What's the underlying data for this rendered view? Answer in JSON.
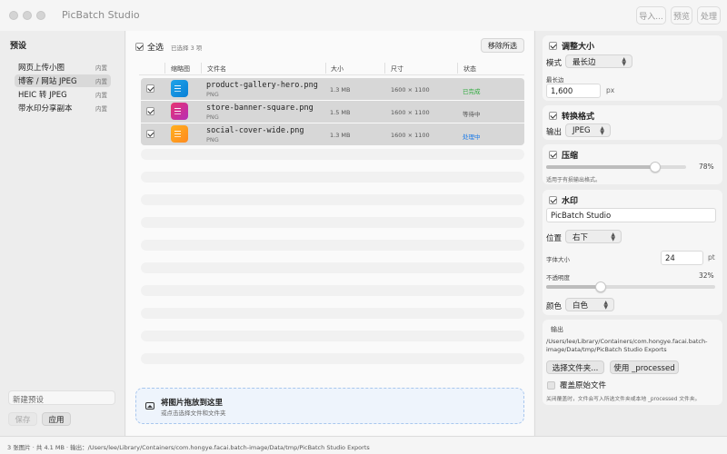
{
  "app": {
    "title": "PicBatch Studio",
    "toolbar": {
      "import": "导入...",
      "preview": "预览",
      "process": "处理"
    }
  },
  "sidebar": {
    "title": "预设",
    "presets": [
      {
        "name": "网页上传小图",
        "tag": "内置"
      },
      {
        "name": "博客 / 网站 JPEG",
        "tag": "内置",
        "selected": true
      },
      {
        "name": "HEIC 转 JPEG",
        "tag": "内置"
      },
      {
        "name": "带水印分享副本",
        "tag": "内置"
      }
    ],
    "new_preset_placeholder": "新建预设",
    "save": "保存",
    "apply": "应用"
  },
  "main": {
    "select_all": "全选",
    "selected_count": "已选择 3 项",
    "remove_selected": "移除所选",
    "columns": {
      "thumb": "缩略图",
      "name": "文件名",
      "size": "大小",
      "dimensions": "尺寸",
      "status": "状态"
    },
    "files": [
      {
        "name": "product-gallery-hero.png",
        "type": "PNG",
        "size": "1.3 MB",
        "dimensions": "1600 × 1100",
        "status": "已完成",
        "status_color": "#2eaa3c",
        "thumb_color": "#1fa3e8",
        "thumb_color2": "#0a7fd6"
      },
      {
        "name": "store-banner-square.png",
        "type": "PNG",
        "size": "1.5 MB",
        "dimensions": "1600 × 1100",
        "status": "等待中",
        "status_color": "#555555",
        "thumb_color": "#e8336f",
        "thumb_color2": "#b52fb8"
      },
      {
        "name": "social-cover-wide.png",
        "type": "PNG",
        "size": "1.3 MB",
        "dimensions": "1600 × 1100",
        "status": "处理中",
        "status_color": "#1a7ae8",
        "thumb_color": "#ffb01f",
        "thumb_color2": "#ff8a1f"
      }
    ],
    "dropzone": {
      "title": "将图片拖放到这里",
      "subtitle": "或点击选择文件和文件夹"
    }
  },
  "settings": {
    "resize": {
      "title": "调整大小",
      "mode_label": "模式",
      "mode": "最长边",
      "long_edge_label": "最长边",
      "long_edge": "1,600",
      "unit": "px"
    },
    "format": {
      "title": "转换格式",
      "output_label": "输出",
      "output": "JPEG"
    },
    "compress": {
      "title": "压缩",
      "quality_text": "78%",
      "quality": 0.78,
      "note": "适用于有损输出格式。"
    },
    "watermark": {
      "title": "水印",
      "text": "PicBatch Studio",
      "position_label": "位置",
      "position": "右下",
      "font_size_label": "字体大小",
      "font_size": "24",
      "font_unit": "pt",
      "opacity_label": "不透明度",
      "opacity_text": "32%",
      "opacity": 0.32,
      "color_label": "颜色",
      "color": "白色"
    },
    "output": {
      "title": "输出",
      "path": "/Users/lee/Library/Containers/com.hongye.facai.batch-image/Data/tmp/PicBatch Studio Exports",
      "choose_folder": "选择文件夹...",
      "use_processed": "使用 _processed",
      "overwrite_label": "覆盖原始文件",
      "overwrite_note": "关闭覆盖时，文件会写入所选文件夹或本地 _processed 文件夹。"
    }
  },
  "status_bar": "3 张图片 · 共 4.1 MB · 输出：/Users/lee/Library/Containers/com.hongye.facai.batch-image/Data/tmp/PicBatch Studio Exports"
}
